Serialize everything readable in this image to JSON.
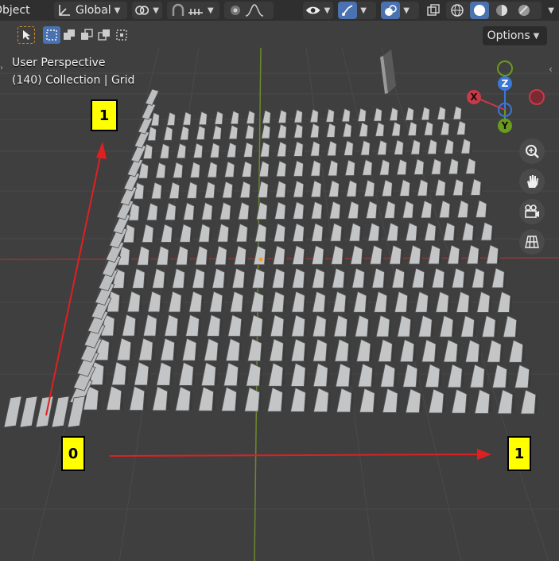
{
  "header": {
    "mode_label": "Object",
    "orientation_label": "Global",
    "options_label": "Options"
  },
  "viewport": {
    "perspective_label": "User Perspective",
    "collection_label": "(140) Collection | Grid"
  },
  "gizmo": {
    "x_label": "X",
    "y_label": "Y",
    "z_label": "Z",
    "x_color": "#c83a48",
    "y_color": "#6a9a1e",
    "z_color": "#3a77d6"
  },
  "annotations": {
    "y_top_label": "1",
    "origin_label": "0",
    "x_right_label": "1",
    "arrow_color": "#e02020",
    "label_bg": "#ffff00"
  },
  "icons": {
    "nav": [
      "zoom-icon",
      "hand-pan-icon",
      "camera-icon",
      "grid-view-icon"
    ],
    "header": [
      "transform-axis-icon",
      "link-icon",
      "snap-magnet-icon",
      "snap-increment-icon",
      "proportional-edit-icon",
      "falloff-icon",
      "visibility-icon",
      "gizmo-icon",
      "overlay-icon",
      "xray-icon",
      "wireframe-shading-icon",
      "solid-shading-icon",
      "material-shading-icon",
      "rendered-shading-icon"
    ]
  }
}
